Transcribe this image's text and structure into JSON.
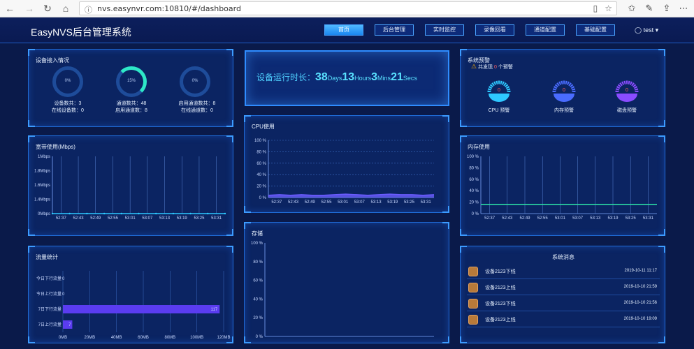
{
  "browser": {
    "url": "nvs.easynvr.com:10810/#/dashboard"
  },
  "app": {
    "title": "EasyNVS后台管理系统",
    "menu": [
      "首页",
      "后台管理",
      "实时监控",
      "录像回看",
      "通道配置",
      "基础配置"
    ],
    "user": "test"
  },
  "device_panel": {
    "title": "设备接入情况",
    "rings": [
      {
        "pct": "0%",
        "value": 0
      },
      {
        "pct": "15%",
        "value": 15
      },
      {
        "pct": "0%",
        "value": 0
      }
    ],
    "stats": [
      [
        "设备数共：3",
        "在线设备数：0"
      ],
      [
        "通道数共：48",
        "启用通道数：8"
      ],
      [
        "启用通道数共：8",
        "在线通道数：0"
      ]
    ]
  },
  "runtime": {
    "label": "设备运行时长：",
    "days": "38",
    "days_unit": "Days",
    "hours": "13",
    "hours_unit": "Hours",
    "mins": "3",
    "mins_unit": "Mins",
    "secs": "21",
    "secs_unit": "Secs"
  },
  "alerts": {
    "title": "系统预警",
    "prefix": "共发现",
    "count": "0",
    "suffix": "个预警",
    "gauges": [
      {
        "label": "CPU 预警",
        "value": "0",
        "color": "#2ec8ff"
      },
      {
        "label": "内存预警",
        "value": "0",
        "color": "#4a6cff"
      },
      {
        "label": "磁盘预警",
        "value": "0",
        "color": "#8a4cff"
      }
    ]
  },
  "charts": {
    "bandwidth_title": "宽带使用(Mbps)",
    "cpu_title": "CPU使用",
    "memory_title": "内存使用",
    "storage_title": "存储",
    "traffic_title": "流量统计",
    "messages_title": "系统消息"
  },
  "chart_data": [
    {
      "type": "line",
      "title": "宽带使用(Mbps)",
      "x": [
        "52:37",
        "52:43",
        "52:49",
        "52:55",
        "53:01",
        "53:07",
        "53:13",
        "53:19",
        "53:25",
        "53:31"
      ],
      "y_ticks": [
        "0Mbps",
        "1.4Mbps",
        "1.6Mbps",
        "1.8Mbps",
        "1Mbps"
      ],
      "series": [
        {
          "values": [
            0,
            0,
            0,
            0,
            0,
            0,
            0,
            0,
            0,
            0,
            0
          ]
        }
      ],
      "ylim": [
        0,
        4
      ]
    },
    {
      "type": "area",
      "title": "CPU使用",
      "x": [
        "52:37",
        "52:43",
        "52:49",
        "52:55",
        "53:01",
        "53:07",
        "53:13",
        "53:19",
        "53:25",
        "53:31"
      ],
      "y_ticks": [
        "0 %",
        "20 %",
        "40 %",
        "60 %",
        "80 %",
        "100 %"
      ],
      "series": [
        {
          "values": [
            4,
            5,
            4,
            5,
            4,
            4,
            5,
            6,
            5,
            4,
            5,
            6,
            5,
            5,
            4,
            5
          ]
        }
      ],
      "ylim": [
        0,
        100
      ]
    },
    {
      "type": "line",
      "title": "内存使用",
      "x": [
        "52:37",
        "52:43",
        "52:49",
        "52:55",
        "53:01",
        "53:07",
        "53:13",
        "53:19",
        "53:25",
        "53:31"
      ],
      "y_ticks": [
        "0 %",
        "20 %",
        "40 %",
        "60 %",
        "80 %",
        "100 %"
      ],
      "series": [
        {
          "values": [
            16,
            16,
            16,
            16,
            16,
            16,
            16,
            16,
            16,
            16,
            16
          ]
        }
      ],
      "ylim": [
        0,
        100
      ]
    },
    {
      "type": "line",
      "title": "存储",
      "y_ticks": [
        "0 %",
        "20 %",
        "40 %",
        "60 %",
        "80 %",
        "100 %"
      ],
      "series": [],
      "ylim": [
        0,
        100
      ]
    },
    {
      "type": "bar",
      "title": "流量统计",
      "categories": [
        "今日下行流量",
        "今日上行流量",
        "7日下行流量",
        "7日上行流量"
      ],
      "values": [
        0,
        0,
        117,
        7
      ],
      "labels": [
        "0",
        "0",
        "117",
        "7"
      ],
      "x_ticks": [
        "0MB",
        "20MB",
        "40MB",
        "60MB",
        "80MB",
        "100MB",
        "120MB"
      ],
      "xlim": [
        0,
        120
      ]
    }
  ],
  "messages": [
    {
      "text": "设备2123下线",
      "time": "2019-10-11 11:17"
    },
    {
      "text": "设备2123上线",
      "time": "2019-10-10 21:59"
    },
    {
      "text": "设备2123下线",
      "time": "2019-10-10 21:56"
    },
    {
      "text": "设备2123上线",
      "time": "2019-10-10 19:09"
    }
  ]
}
